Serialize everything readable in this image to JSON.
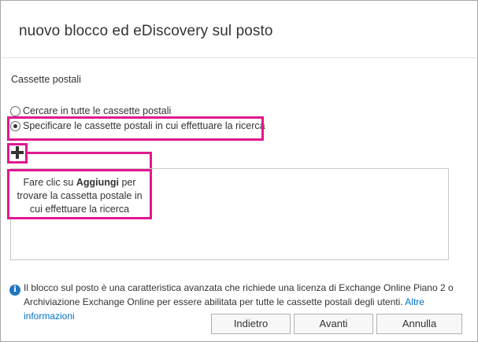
{
  "dialog": {
    "title": "nuovo blocco ed eDiscovery sul posto"
  },
  "mailboxes": {
    "section_label": "Cassette postali",
    "options": [
      {
        "label": "Cercare in tutte le cassette postali",
        "selected": false
      },
      {
        "label": "Specificare le cassette postali in cui effettuare la ricerca",
        "selected": true
      }
    ],
    "add_icon": "plus-icon"
  },
  "callout": {
    "text_before": "Fare clic su ",
    "text_bold": "Aggiungi",
    "text_after": " per trovare la cassetta postale in cui effettuare la ricerca",
    "color": "#e0188e"
  },
  "info": {
    "icon": "info-icon",
    "text": "Il blocco sul posto è una caratteristica avanzata che richiede una licenza di Exchange Online Piano 2 o Archiviazione Exchange Online per essere abilitata per tutte le cassette postali degli utenti. ",
    "link_label": "Altre informazioni"
  },
  "buttons": {
    "back_label": "Indietro",
    "next_label": "Avanti",
    "cancel_label": "Annulla"
  },
  "colors": {
    "accent_link": "#0072c6",
    "info_icon": "#1f76c2",
    "highlight": "#e0188e"
  }
}
